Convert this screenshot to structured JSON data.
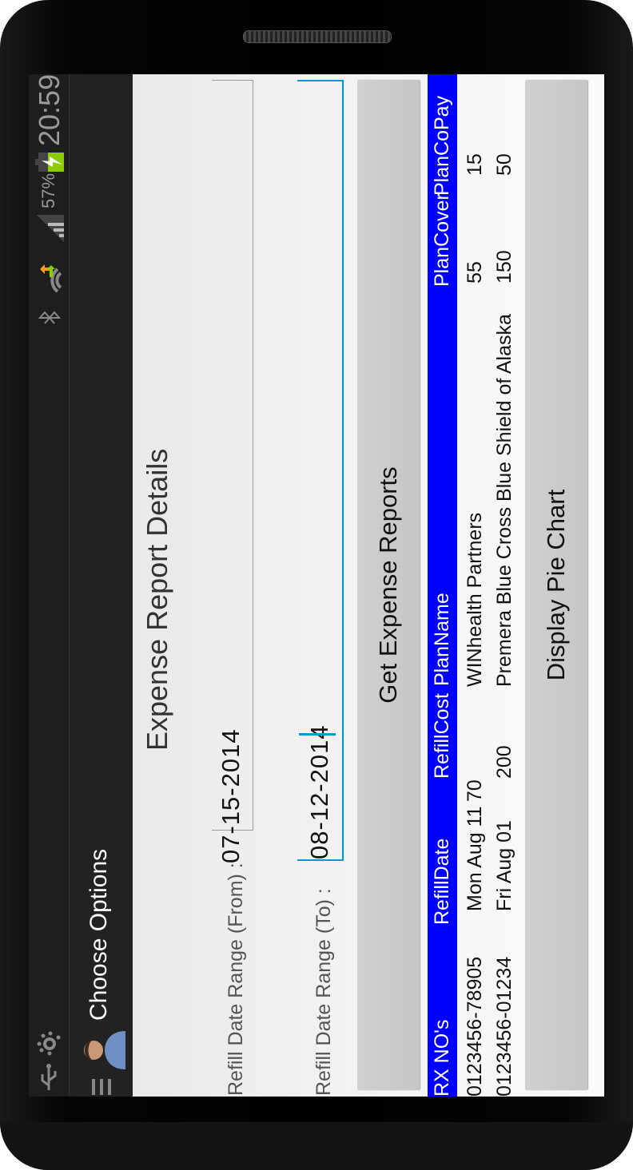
{
  "status_bar": {
    "time": "20:59",
    "battery": "57%",
    "icons": [
      "usb-icon",
      "app-icon",
      "bluetooth-icon",
      "wifi-icon",
      "signal-icon",
      "battery-charging-icon"
    ]
  },
  "action_bar": {
    "title": "Choose Options"
  },
  "title": "Expense Report Details",
  "form": {
    "from_label": "Refill Date Range (From) :",
    "from_value": "07-15-2014",
    "to_label": "Refill Date Range (To) :",
    "to_value": "08-12-2014"
  },
  "buttons": {
    "get_reports": "Get Expense Reports",
    "pie_chart": "Display Pie Chart"
  },
  "table": {
    "headers": [
      "RX NO's",
      "RefillDate",
      "RefillCost",
      "PlanName",
      "PlanCover",
      "PlanCoPay"
    ],
    "rows": [
      [
        "0123456-78905",
        "Mon Aug 11",
        "70",
        "WINhealth Partners",
        "55",
        "15"
      ],
      [
        "0123456-01234",
        "Fri Aug 01",
        "200",
        "Premera Blue Cross Blue Shield of Alaska",
        "150",
        "50"
      ]
    ]
  },
  "colors": {
    "header_bg": "#0000ff",
    "focus": "#0099cc",
    "battery": "#8ccc00"
  }
}
